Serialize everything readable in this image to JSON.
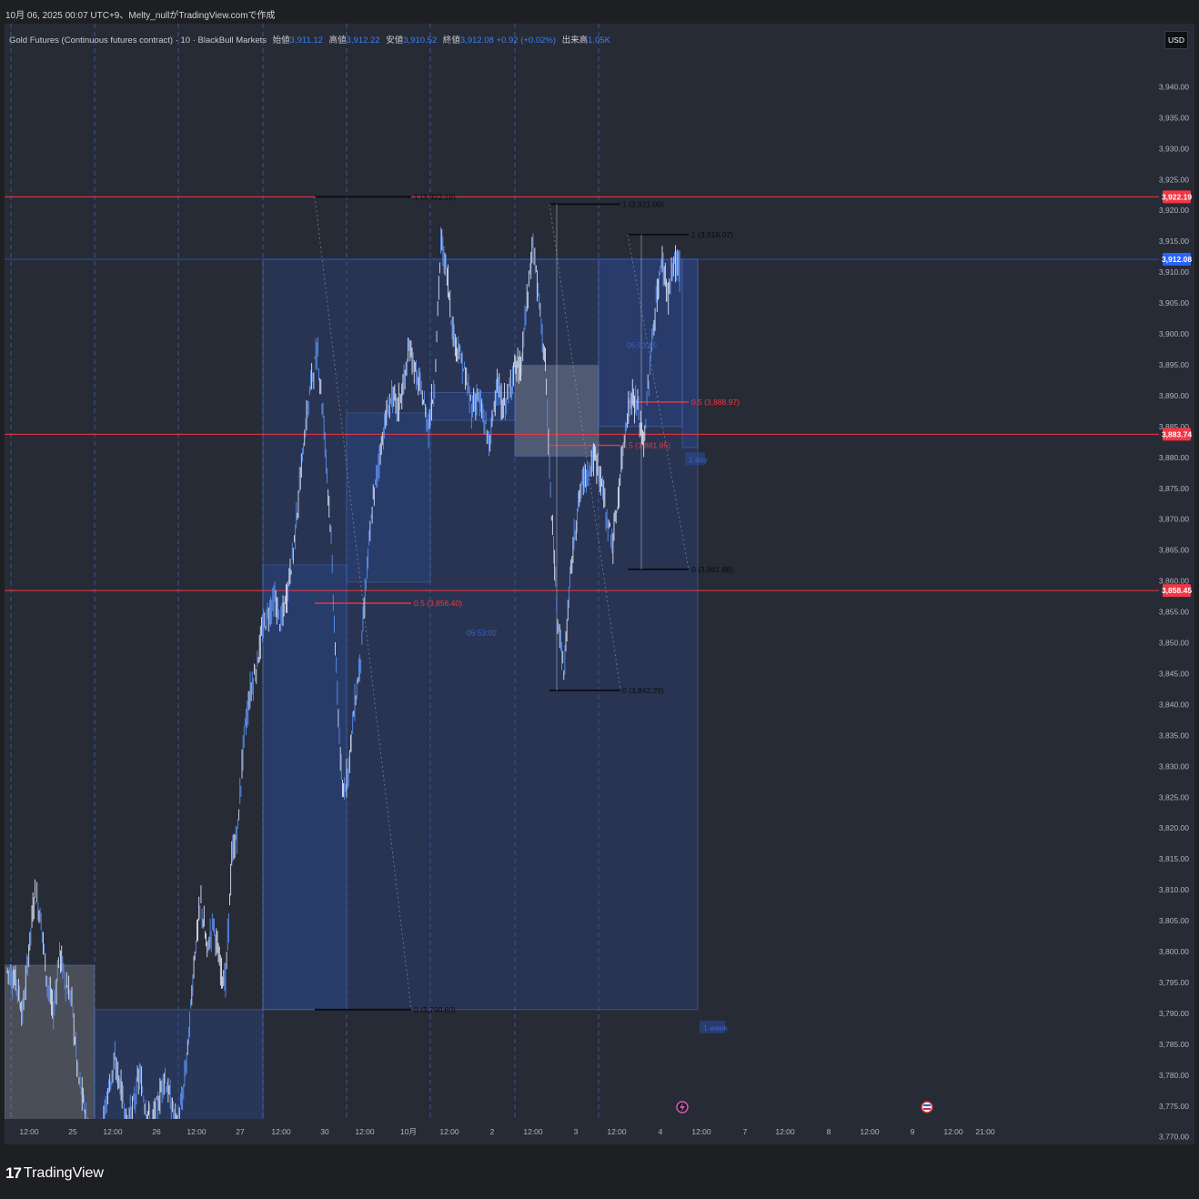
{
  "header": {
    "timestamp": "10月 06, 2025 00:07 UTC+9、Melty_nullがTradingView.comで作成",
    "symbol": "Gold Futures (Continuous futures contract) · 10 · BlackBull Markets",
    "open_label": "始値",
    "open": "3,911.12",
    "high_label": "高値",
    "high": "3,912.22",
    "low_label": "安値",
    "low": "3,910.52",
    "close_label": "終値",
    "close": "3,912.08",
    "change": "+0.92 (+0.02%)",
    "volume_label": "出来高",
    "volume": "1.05K",
    "currency": "USD"
  },
  "brand": {
    "mark": "17",
    "name": "TradingView"
  },
  "colors": {
    "background": "#272b35",
    "grid_dash": "#3f5f9c",
    "candle": "#5b8ff0",
    "hline_red": "#f23645",
    "current_price": "#2962ff",
    "box_fill": "#2a4a9a"
  },
  "chart_data": {
    "type": "candlestick",
    "title": "",
    "xlabel": "",
    "ylabel": "",
    "ylim": [
      3768,
      3946
    ],
    "y_ticks": [
      "3,940.00",
      "3,935.00",
      "3,930.00",
      "3,925.00",
      "3,920.00",
      "3,915.00",
      "3,910.00",
      "3,905.00",
      "3,900.00",
      "3,895.00",
      "3,890.00",
      "3,885.00",
      "3,880.00",
      "3,875.00",
      "3,870.00",
      "3,865.00",
      "3,860.00",
      "3,855.00",
      "3,850.00",
      "3,845.00",
      "3,840.00",
      "3,835.00",
      "3,830.00",
      "3,825.00",
      "3,820.00",
      "3,815.00",
      "3,810.00",
      "3,805.00",
      "3,800.00",
      "3,795.00",
      "3,790.00",
      "3,785.00",
      "3,780.00",
      "3,775.00",
      "3,770.00"
    ],
    "x_ticks": [
      "12:00",
      "25",
      "12:00",
      "26",
      "12:00",
      "27",
      "12:00",
      "30",
      "12:00",
      "10月",
      "12:00",
      "2",
      "12:00",
      "3",
      "12:00",
      "4",
      "12:00",
      "7",
      "12:00",
      "8",
      "12:00",
      "9",
      "12:00",
      "21:00"
    ],
    "price_tags": [
      {
        "value": 3922.19,
        "label": "3,922.19",
        "color": "#f23645"
      },
      {
        "value": 3912.08,
        "label": "3,912.08",
        "color": "#2962ff"
      },
      {
        "value": 3883.74,
        "label": "3,883.74",
        "color": "#f23645"
      },
      {
        "value": 3858.45,
        "label": "3,858.45",
        "color": "#f23645"
      }
    ],
    "horizontal_lines": [
      3922.19,
      3883.74,
      3858.45
    ],
    "fib_levels": [
      {
        "label": "1 (3,922.19)",
        "value": 3922.19
      },
      {
        "label": "0.5 (3,856.40)",
        "value": 3856.4
      },
      {
        "label": "0 (3,790.60)",
        "value": 3790.6
      },
      {
        "label": "1 (3,921.00)",
        "value": 3921.0
      },
      {
        "label": "0.5 (3,881.95)",
        "value": 3881.95
      },
      {
        "label": "0 (3,842.29)",
        "value": 3842.29
      },
      {
        "label": "1 (3,916.07)",
        "value": 3916.07
      },
      {
        "label": "0.5 (3,888.97)",
        "value": 3888.97
      },
      {
        "label": "0 (3,861.88)",
        "value": 3861.88
      }
    ],
    "annotations": [
      "05:53:05",
      "05:53:02",
      "1 day",
      "1 week"
    ],
    "close_path": [
      [
        0,
        3797
      ],
      [
        3,
        3795
      ],
      [
        5,
        3790
      ],
      [
        7,
        3800
      ],
      [
        9,
        3810
      ],
      [
        11,
        3805
      ],
      [
        13,
        3795
      ],
      [
        15,
        3790
      ],
      [
        17,
        3800
      ],
      [
        19,
        3795
      ],
      [
        21,
        3792
      ],
      [
        23,
        3780
      ],
      [
        25,
        3775
      ],
      [
        27,
        3770
      ],
      [
        29,
        3770
      ],
      [
        31,
        3772
      ],
      [
        33,
        3778
      ],
      [
        35,
        3782
      ],
      [
        37,
        3778
      ],
      [
        39,
        3772
      ],
      [
        41,
        3775
      ],
      [
        43,
        3780
      ],
      [
        45,
        3775
      ],
      [
        47,
        3772
      ],
      [
        49,
        3775
      ],
      [
        51,
        3780
      ],
      [
        53,
        3776
      ],
      [
        55,
        3772
      ],
      [
        57,
        3776
      ],
      [
        59,
        3786
      ],
      [
        61,
        3800
      ],
      [
        63,
        3808
      ],
      [
        65,
        3800
      ],
      [
        67,
        3805
      ],
      [
        69,
        3798
      ],
      [
        71,
        3795
      ],
      [
        73,
        3815
      ],
      [
        75,
        3820
      ],
      [
        77,
        3835
      ],
      [
        79,
        3842
      ],
      [
        81,
        3846
      ],
      [
        83,
        3852
      ],
      [
        85,
        3855
      ],
      [
        87,
        3857
      ],
      [
        89,
        3853
      ],
      [
        91,
        3858
      ],
      [
        93,
        3865
      ],
      [
        95,
        3875
      ],
      [
        97,
        3885
      ],
      [
        99,
        3893
      ],
      [
        101,
        3897
      ],
      [
        103,
        3885
      ],
      [
        105,
        3870
      ],
      [
        107,
        3845
      ],
      [
        109,
        3825
      ],
      [
        111,
        3830
      ],
      [
        113,
        3840
      ],
      [
        115,
        3848
      ],
      [
        117,
        3862
      ],
      [
        119,
        3873
      ],
      [
        121,
        3880
      ],
      [
        123,
        3886
      ],
      [
        125,
        3890
      ],
      [
        127,
        3888
      ],
      [
        129,
        3892
      ],
      [
        131,
        3898
      ],
      [
        133,
        3893
      ],
      [
        135,
        3890
      ],
      [
        137,
        3885
      ],
      [
        139,
        3892
      ],
      [
        141,
        3915
      ],
      [
        143,
        3910
      ],
      [
        145,
        3900
      ],
      [
        147,
        3897
      ],
      [
        149,
        3893
      ],
      [
        151,
        3888
      ],
      [
        153,
        3890
      ],
      [
        155,
        3886
      ],
      [
        157,
        3882
      ],
      [
        159,
        3892
      ],
      [
        161,
        3888
      ],
      [
        163,
        3890
      ],
      [
        165,
        3895
      ],
      [
        167,
        3894
      ],
      [
        169,
        3905
      ],
      [
        171,
        3915
      ],
      [
        173,
        3905
      ],
      [
        175,
        3895
      ],
      [
        177,
        3870
      ],
      [
        179,
        3855
      ],
      [
        181,
        3845
      ],
      [
        183,
        3860
      ],
      [
        185,
        3870
      ],
      [
        187,
        3876
      ],
      [
        189,
        3878
      ],
      [
        191,
        3880
      ],
      [
        193,
        3877
      ],
      [
        195,
        3870
      ],
      [
        197,
        3866
      ],
      [
        199,
        3875
      ],
      [
        201,
        3885
      ],
      [
        203,
        3890
      ],
      [
        205,
        3888
      ],
      [
        207,
        3882
      ],
      [
        209,
        3895
      ],
      [
        211,
        3905
      ],
      [
        213,
        3912
      ],
      [
        215,
        3906
      ],
      [
        217,
        3912
      ],
      [
        219,
        3910
      ]
    ]
  }
}
